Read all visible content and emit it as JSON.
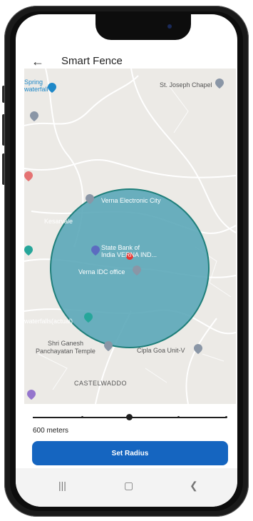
{
  "appbar": {
    "back_icon": "arrow-left-icon",
    "title": "Smart Fence"
  },
  "map": {
    "labels": {
      "spring_waterfall": "Spring\nwaterfall",
      "st_joseph": "St. Joseph Chapel",
      "verna_electronic": "Verna Electronic City",
      "kesarval": "Kesarvale",
      "sbi": "State Bank of\nIndia VERNA IND...",
      "verna_idc": "Verna IDC office",
      "waterfalls_actual": "waterfalls(actual)",
      "shri_ganesh": "Shri Ganesh\nPanchayatan Temple",
      "cipla": "Cipla Goa Unit-V",
      "castelwaddo": "CASTELWADDO"
    },
    "fence_color": "#5ba7b8",
    "fence_border_color": "#1f7f7a"
  },
  "slider": {
    "value_label": "600 meters",
    "position_fraction": 0.5
  },
  "set_radius_button": {
    "label": "Set Radius",
    "color": "#1565c0"
  },
  "navbar": {
    "recents_icon": "recents-icon",
    "home_icon": "home-icon",
    "back_icon": "back-chevron-icon"
  }
}
